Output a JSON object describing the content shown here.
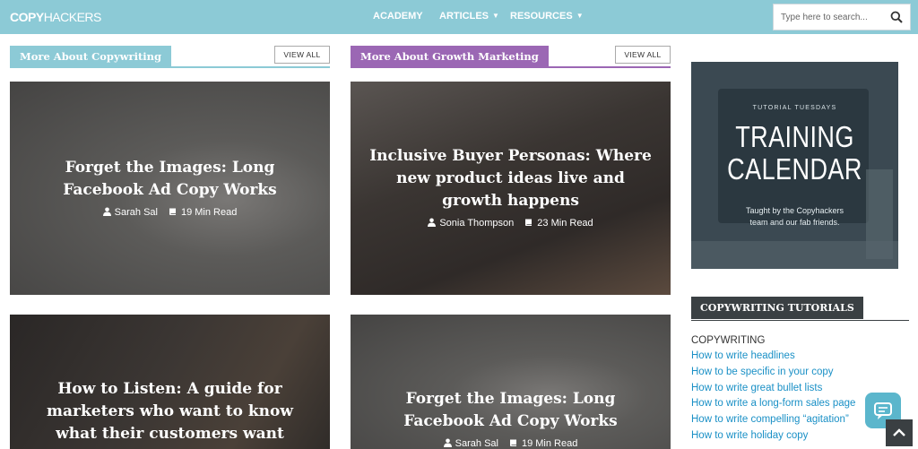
{
  "brand": {
    "logo_bold": "COPY",
    "logo_thin": "HACKERS"
  },
  "nav": {
    "items": [
      {
        "label": "ACADEMY",
        "has_dropdown": false
      },
      {
        "label": "ARTICLES",
        "has_dropdown": true
      },
      {
        "label": "RESOURCES",
        "has_dropdown": true
      }
    ]
  },
  "search": {
    "placeholder": "Type here to search...",
    "value": ""
  },
  "sections": [
    {
      "title": "More About Copywriting",
      "view_all": "VIEW ALL",
      "color": "#8ccad6"
    },
    {
      "title": "More About Growth Marketing",
      "view_all": "VIEW ALL",
      "color": "#9b67b4"
    }
  ],
  "cards": [
    {
      "title": "Forget the Images: Long Facebook Ad Copy Works",
      "author": "Sarah Sal",
      "read_time": "19 Min Read"
    },
    {
      "title": "Inclusive Buyer Personas: Where new product ideas live and growth happens",
      "author": "Sonia Thompson",
      "read_time": "23 Min Read"
    },
    {
      "title": "How to Listen: A guide for marketers who want to know what their customers want",
      "author": "",
      "read_time": ""
    },
    {
      "title": "Forget the Images: Long Facebook Ad Copy Works",
      "author": "Sarah Sal",
      "read_time": "19 Min Read"
    }
  ],
  "promo": {
    "kicker": "TUTORIAL TUESDAYS",
    "headline_line1": "TRAINING",
    "headline_line2": "CALENDAR",
    "sub_line1": "Taught by the Copyhackers",
    "sub_line2": "team and our fab friends."
  },
  "tutorials": {
    "heading": "COPYWRITING TUTORIALS",
    "category": "COPYWRITING",
    "links": [
      "How to write headlines",
      "How to be specific in your copy",
      "How to write great bullet lists",
      "How to write a long-form sales page",
      "How to write compelling “agitation”",
      "How to write holiday copy"
    ]
  },
  "icons": {
    "search": "search-icon",
    "author": "user-icon",
    "read_time": "book-icon",
    "chat": "chat-bubble-icon",
    "back_to_top": "chevron-up-icon"
  },
  "colors": {
    "topbar": "#8ccad6",
    "growth_accent": "#9b67b4",
    "link": "#1a90c6",
    "dark": "#3a4043"
  }
}
